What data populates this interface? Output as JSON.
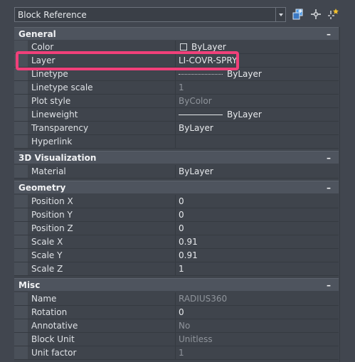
{
  "selector": {
    "value": "Block Reference"
  },
  "sections": {
    "general": {
      "title": "General",
      "rows": [
        {
          "name": "Color",
          "value": "ByLayer"
        },
        {
          "name": "Layer",
          "value": "LI-COVR-SPRY"
        },
        {
          "name": "Linetype",
          "value": "ByLayer"
        },
        {
          "name": "Linetype scale",
          "value": "1"
        },
        {
          "name": "Plot style",
          "value": "ByColor"
        },
        {
          "name": "Lineweight",
          "value": "ByLayer"
        },
        {
          "name": "Transparency",
          "value": "ByLayer"
        },
        {
          "name": "Hyperlink",
          "value": ""
        }
      ]
    },
    "viz": {
      "title": "3D Visualization",
      "rows": [
        {
          "name": "Material",
          "value": "ByLayer"
        }
      ]
    },
    "geometry": {
      "title": "Geometry",
      "rows": [
        {
          "name": "Position X",
          "value": "0"
        },
        {
          "name": "Position Y",
          "value": "0"
        },
        {
          "name": "Position Z",
          "value": "0"
        },
        {
          "name": "Scale X",
          "value": "0.91"
        },
        {
          "name": "Scale Y",
          "value": "0.91"
        },
        {
          "name": "Scale Z",
          "value": "1"
        }
      ]
    },
    "misc": {
      "title": "Misc",
      "rows": [
        {
          "name": "Name",
          "value": "RADIUS360"
        },
        {
          "name": "Rotation",
          "value": "0"
        },
        {
          "name": "Annotative",
          "value": "No"
        },
        {
          "name": "Block Unit",
          "value": "Unitless"
        },
        {
          "name": "Unit factor",
          "value": "1"
        }
      ]
    }
  },
  "collapse_glyph": "–",
  "colors": {
    "highlight": "#f0407a"
  }
}
